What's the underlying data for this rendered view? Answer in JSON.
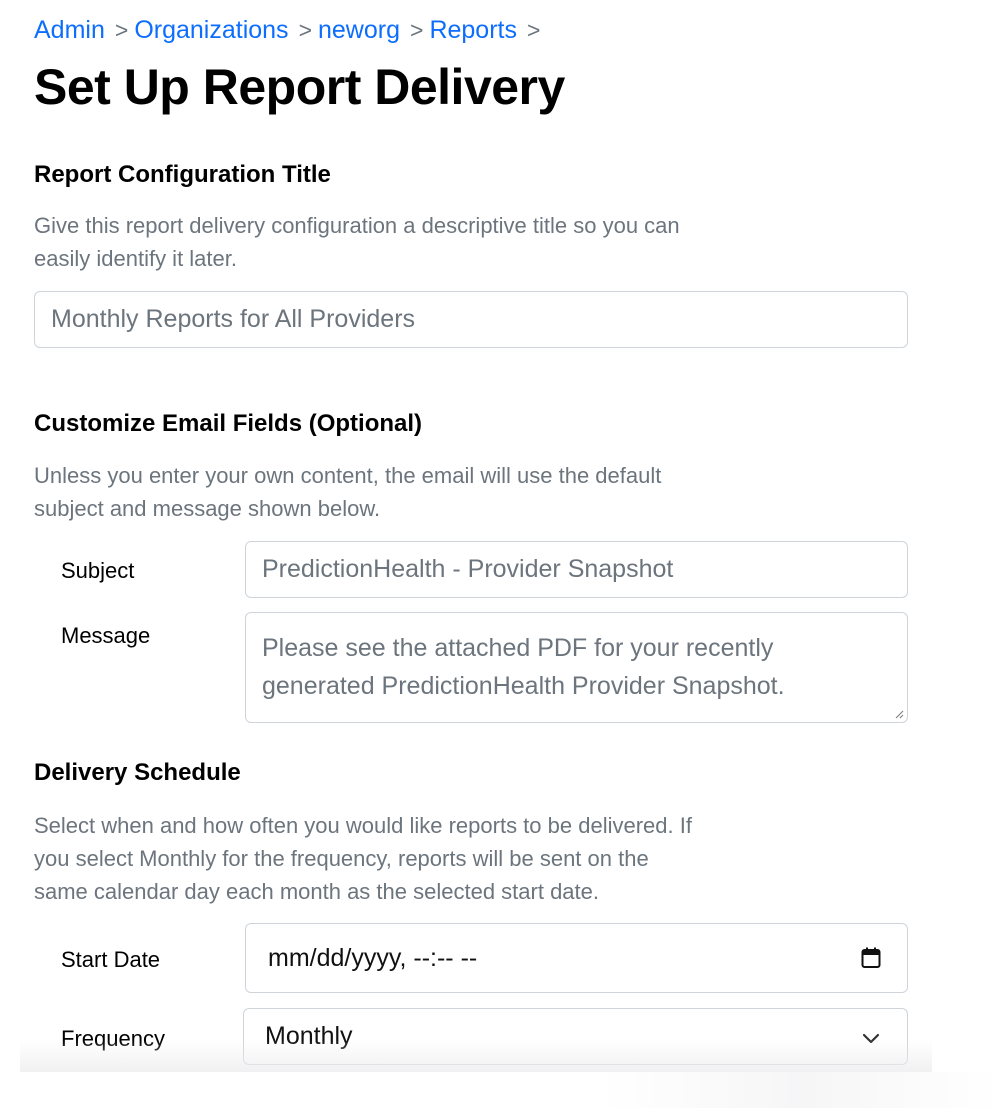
{
  "breadcrumb": [
    {
      "label": "Admin"
    },
    {
      "label": "Organizations"
    },
    {
      "label": "neworg"
    },
    {
      "label": "Reports"
    }
  ],
  "breadcrumb_separator": ">",
  "page_title": "Set Up Report Delivery",
  "config_section": {
    "title": "Report Configuration Title",
    "help_line1": "Give this report delivery configuration a descriptive title so you can",
    "help_line2": "easily identify it later.",
    "title_placeholder": "Monthly Reports for All Providers"
  },
  "email_section": {
    "title": "Customize Email Fields (Optional)",
    "help_line1": "Unless you enter your own content, the email will use the default",
    "help_line2": "subject and message shown below.",
    "subject_label": "Subject",
    "subject_placeholder": "PredictionHealth - Provider Snapshot",
    "message_label": "Message",
    "message_line1": "Please see the attached PDF for your recently",
    "message_line2": "generated PredictionHealth Provider Snapshot."
  },
  "schedule_section": {
    "title": "Delivery Schedule",
    "help_line1": "Select when and how often you would like reports to be delivered. If",
    "help_line2": "you select Monthly for the frequency, reports will be sent on the",
    "help_line3": "same calendar day each month as the selected start date.",
    "start_date_label": "Start Date",
    "start_date_value": "mm/dd/yyyy, --:-- --",
    "frequency_label": "Frequency",
    "frequency_value": "Monthly"
  },
  "colors": {
    "link": "#0d6efd",
    "muted": "#6c757d",
    "border": "#ced4da"
  },
  "icons": [
    "calendar-icon",
    "chevron-down-icon",
    "resize-grip-icon"
  ]
}
